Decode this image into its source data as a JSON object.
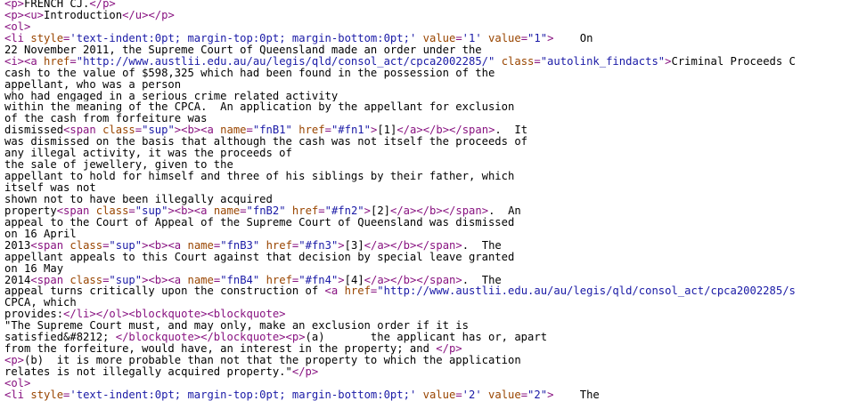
{
  "colors": {
    "tag": "#881280",
    "attr_name": "#994500",
    "attr_value": "#1a1aa6",
    "text": "#000000",
    "background": "#ffffff"
  },
  "lines": [
    [
      [
        "t",
        "<p>"
      ],
      [
        "x",
        "FRENCH CJ."
      ],
      [
        "t",
        "</p>"
      ]
    ],
    [
      [
        "t",
        "<p><u>"
      ],
      [
        "x",
        "Introduction"
      ],
      [
        "t",
        "</u></p>"
      ]
    ],
    [
      [
        "t",
        "<ol>"
      ]
    ],
    [
      [
        "t",
        "<li "
      ],
      [
        "a",
        "style"
      ],
      [
        "t",
        "="
      ],
      [
        "v",
        "'text-indent:0pt; margin-top:0pt; margin-bottom:0pt;'"
      ],
      [
        "t",
        " "
      ],
      [
        "a",
        "value"
      ],
      [
        "t",
        "="
      ],
      [
        "v",
        "'1'"
      ],
      [
        "t",
        " "
      ],
      [
        "a",
        "value"
      ],
      [
        "t",
        "="
      ],
      [
        "v",
        "\"1\""
      ],
      [
        "t",
        ">"
      ],
      [
        "x",
        "    On"
      ]
    ],
    [
      [
        "x",
        "22 November 2011, the Supreme Court of Queensland made an order under the"
      ]
    ],
    [
      [
        "t",
        "<i><a "
      ],
      [
        "a",
        "href"
      ],
      [
        "t",
        "="
      ],
      [
        "v",
        "\"http://www.austlii.edu.au/au/legis/qld/consol_act/cpca2002285/\""
      ],
      [
        "t",
        " "
      ],
      [
        "a",
        "class"
      ],
      [
        "t",
        "="
      ],
      [
        "v",
        "\"autolink_findacts\""
      ],
      [
        "t",
        ">"
      ],
      [
        "x",
        "Criminal Proceeds C"
      ]
    ],
    [
      [
        "x",
        "cash to the value of $598,325 which had been found in the possession of the"
      ]
    ],
    [
      [
        "x",
        "appellant, who was a person"
      ]
    ],
    [
      [
        "x",
        "who had engaged in a serious crime related activity"
      ]
    ],
    [
      [
        "x",
        "within the meaning of the CPCA.  An application by the appellant for exclusion"
      ]
    ],
    [
      [
        "x",
        "of the cash from forfeiture was"
      ]
    ],
    [
      [
        "x",
        "dismissed"
      ],
      [
        "t",
        "<span "
      ],
      [
        "a",
        "class"
      ],
      [
        "t",
        "="
      ],
      [
        "v",
        "\"sup\""
      ],
      [
        "t",
        "><b><a "
      ],
      [
        "a",
        "name"
      ],
      [
        "t",
        "="
      ],
      [
        "v",
        "\"fnB1\""
      ],
      [
        "t",
        " "
      ],
      [
        "a",
        "href"
      ],
      [
        "t",
        "="
      ],
      [
        "v",
        "\"#fn1\""
      ],
      [
        "t",
        ">"
      ],
      [
        "x",
        "[1]"
      ],
      [
        "t",
        "</a></b></span>"
      ],
      [
        "x",
        ".  It"
      ]
    ],
    [
      [
        "x",
        "was dismissed on the basis that although the cash was not itself the proceeds of"
      ]
    ],
    [
      [
        "x",
        "any illegal activity, it was the proceeds of"
      ]
    ],
    [
      [
        "x",
        "the sale of jewellery, given to the"
      ]
    ],
    [
      [
        "x",
        "appellant to hold for himself and three of his siblings by their father, which"
      ]
    ],
    [
      [
        "x",
        "itself was not"
      ]
    ],
    [
      [
        "x",
        "shown not to have been illegally acquired"
      ]
    ],
    [
      [
        "x",
        "property"
      ],
      [
        "t",
        "<span "
      ],
      [
        "a",
        "class"
      ],
      [
        "t",
        "="
      ],
      [
        "v",
        "\"sup\""
      ],
      [
        "t",
        "><b><a "
      ],
      [
        "a",
        "name"
      ],
      [
        "t",
        "="
      ],
      [
        "v",
        "\"fnB2\""
      ],
      [
        "t",
        " "
      ],
      [
        "a",
        "href"
      ],
      [
        "t",
        "="
      ],
      [
        "v",
        "\"#fn2\""
      ],
      [
        "t",
        ">"
      ],
      [
        "x",
        "[2]"
      ],
      [
        "t",
        "</a></b></span>"
      ],
      [
        "x",
        ".  An"
      ]
    ],
    [
      [
        "x",
        "appeal to the Court of Appeal of the Supreme Court of Queensland was dismissed"
      ]
    ],
    [
      [
        "x",
        "on 16 April"
      ]
    ],
    [
      [
        "x",
        "2013"
      ],
      [
        "t",
        "<span "
      ],
      [
        "a",
        "class"
      ],
      [
        "t",
        "="
      ],
      [
        "v",
        "\"sup\""
      ],
      [
        "t",
        "><b><a "
      ],
      [
        "a",
        "name"
      ],
      [
        "t",
        "="
      ],
      [
        "v",
        "\"fnB3\""
      ],
      [
        "t",
        " "
      ],
      [
        "a",
        "href"
      ],
      [
        "t",
        "="
      ],
      [
        "v",
        "\"#fn3\""
      ],
      [
        "t",
        ">"
      ],
      [
        "x",
        "[3]"
      ],
      [
        "t",
        "</a></b></span>"
      ],
      [
        "x",
        ".  The"
      ]
    ],
    [
      [
        "x",
        "appellant appeals to this Court against that decision by special leave granted"
      ]
    ],
    [
      [
        "x",
        "on 16 May"
      ]
    ],
    [
      [
        "x",
        "2014"
      ],
      [
        "t",
        "<span "
      ],
      [
        "a",
        "class"
      ],
      [
        "t",
        "="
      ],
      [
        "v",
        "\"sup\""
      ],
      [
        "t",
        "><b><a "
      ],
      [
        "a",
        "name"
      ],
      [
        "t",
        "="
      ],
      [
        "v",
        "\"fnB4\""
      ],
      [
        "t",
        " "
      ],
      [
        "a",
        "href"
      ],
      [
        "t",
        "="
      ],
      [
        "v",
        "\"#fn4\""
      ],
      [
        "t",
        ">"
      ],
      [
        "x",
        "[4]"
      ],
      [
        "t",
        "</a></b></span>"
      ],
      [
        "x",
        ".  The"
      ]
    ],
    [
      [
        "x",
        "appeal turns critically upon the construction of "
      ],
      [
        "t",
        "<a "
      ],
      [
        "a",
        "href"
      ],
      [
        "t",
        "="
      ],
      [
        "v",
        "\"http://www.austlii.edu.au/au/legis/qld/consol_act/cpca2002285/s"
      ]
    ],
    [
      [
        "x",
        "CPCA, which"
      ]
    ],
    [
      [
        "x",
        "provides:"
      ],
      [
        "t",
        "</li></ol><blockquote><blockquote>"
      ]
    ],
    [
      [
        "x",
        "\"The Supreme Court must, and may only, make an exclusion order if it is"
      ]
    ],
    [
      [
        "x",
        "satisfied&#8212; "
      ],
      [
        "t",
        "</blockquote></blockquote><p>"
      ],
      [
        "x",
        "(a)       the applicant has or, apart"
      ]
    ],
    [
      [
        "x",
        "from the forfeiture, would have, an interest in the property; and "
      ],
      [
        "t",
        "</p>"
      ]
    ],
    [
      [
        "t",
        "<p>"
      ],
      [
        "x",
        "(b)  it is more probable than not that the property to which the application"
      ]
    ],
    [
      [
        "x",
        "relates is not illegally acquired property.\""
      ],
      [
        "t",
        "</p>"
      ]
    ],
    [
      [
        "t",
        "<ol>"
      ]
    ],
    [
      [
        "t",
        "<li "
      ],
      [
        "a",
        "style"
      ],
      [
        "t",
        "="
      ],
      [
        "v",
        "'text-indent:0pt; margin-top:0pt; margin-bottom:0pt;'"
      ],
      [
        "t",
        " "
      ],
      [
        "a",
        "value"
      ],
      [
        "t",
        "="
      ],
      [
        "v",
        "'2'"
      ],
      [
        "t",
        " "
      ],
      [
        "a",
        "value"
      ],
      [
        "t",
        "="
      ],
      [
        "v",
        "\"2\""
      ],
      [
        "t",
        ">"
      ],
      [
        "x",
        "    The"
      ]
    ]
  ]
}
